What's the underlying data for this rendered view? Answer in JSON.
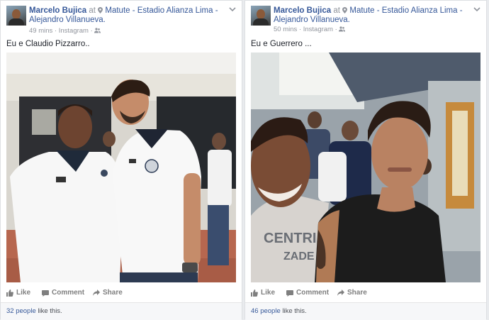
{
  "posts": [
    {
      "author": "Marcelo Bujica",
      "at_word": "at",
      "location": "Matute - Estadio Alianza Lima - Alejandro Villanueva.",
      "time": "49 mins",
      "source": "Instagram",
      "separator": "·",
      "caption": "Eu e Claudio Pizzarro..",
      "actions": {
        "like": "Like",
        "comment": "Comment",
        "share": "Share"
      },
      "likes_count": "32 people",
      "likes_text": "like this."
    },
    {
      "author": "Marcelo Bujica",
      "at_word": "at",
      "location": "Matute - Estadio Alianza Lima - Alejandro Villanueva.",
      "time": "50 mins",
      "source": "Instagram",
      "separator": "·",
      "caption": "Eu e Guerrero ...",
      "actions": {
        "like": "Like",
        "comment": "Comment",
        "share": "Share"
      },
      "likes_count": "46 people",
      "likes_text": "like this."
    }
  ],
  "colors": {
    "link": "#365899",
    "meta": "#90949c",
    "background": "#e9ebee"
  },
  "icons": [
    "location-pin-icon",
    "friends-icon",
    "chevron-down-icon",
    "like-icon",
    "comment-icon",
    "share-icon"
  ]
}
